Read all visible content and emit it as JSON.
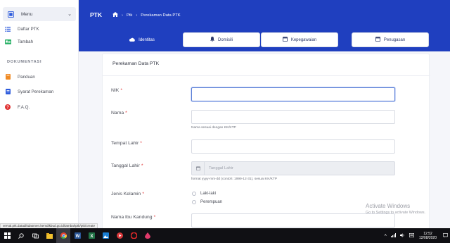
{
  "sidebar": {
    "menu_label": "Menu",
    "items": [
      {
        "label": "Daftar PTK"
      },
      {
        "label": "Tambah"
      }
    ],
    "section_title": "DOKUMENTASI",
    "docs": [
      {
        "label": "Panduan"
      },
      {
        "label": "Syarat Perekaman"
      },
      {
        "label": "F.A.Q."
      }
    ]
  },
  "header": {
    "title": "PTK",
    "breadcrumb": {
      "item1": "Ptk",
      "item2": "Perekaman Data PTK"
    }
  },
  "tabs": [
    {
      "label": "Identitas",
      "active": true
    },
    {
      "label": "Domisili"
    },
    {
      "label": "Kepegawaian"
    },
    {
      "label": "Penugasan"
    }
  ],
  "form": {
    "card_title": "Perekaman Data PTK",
    "nik": {
      "label": "NIK",
      "required": "*",
      "value": ""
    },
    "nama": {
      "label": "Nama",
      "required": "*",
      "value": "",
      "help": "Nama sesuai dengan KK/KTP"
    },
    "tempat_lahir": {
      "label": "Tempat Lahir",
      "required": "*",
      "value": ""
    },
    "tanggal_lahir": {
      "label": "Tanggal Lahir",
      "required": "*",
      "placeholder": "Tanggal Lahir",
      "help": "format yyyy-mm-dd (contoh: 1999-12-31), sesuai KK/KTP"
    },
    "jenis_kelamin": {
      "label": "Jenis Kelamin",
      "required": "*",
      "options": [
        "Laki-laki",
        "Perempuan"
      ]
    },
    "nama_ibu": {
      "label": "Nama Ibu Kandung",
      "required": "*",
      "value": ""
    }
  },
  "status_url": "verval.ptk.datadikdasmen.kemdikbud.go.id/tambahptk/ptk/create",
  "watermark": {
    "line1": "Activate Windows",
    "line2": "Go to Settings to activate Windows."
  },
  "taskbar": {
    "time": "12:52",
    "date": "12/08/2020"
  },
  "colors": {
    "brand": "#1f3fbf",
    "required": "#e03131"
  }
}
